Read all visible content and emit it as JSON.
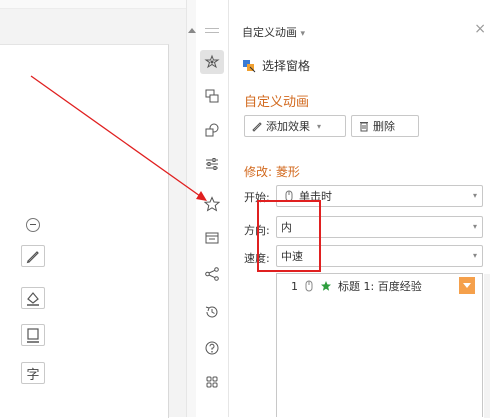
{
  "canvas": {
    "float_tools": [
      {
        "icon": "pen-icon"
      },
      {
        "icon": "shape-fill-icon"
      },
      {
        "icon": "outline-icon"
      },
      {
        "icon": "text-wrap-icon",
        "text": "字"
      }
    ]
  },
  "iconbar": {
    "icons": [
      "animation-icon",
      "transition-icon",
      "shapes-icon",
      "settings-sliders-icon",
      "star-icon",
      "layout-icon",
      "share-icon",
      "history-icon",
      "help-icon",
      "grid-icon"
    ]
  },
  "panel": {
    "title": "自定义动画",
    "title_caret": "▾",
    "close": "×",
    "selection_pane": "选择窗格",
    "section_title": "自定义动画",
    "add_effect": "添加效果",
    "add_effect_caret": "▾",
    "delete": "删除",
    "modify_label": "修改: 菱形",
    "start_label": "开始:",
    "start_value": "单击时",
    "direction_label": "方向:",
    "direction_value": "内",
    "speed_label": "速度:",
    "speed_value": "中速",
    "dd_caret": "▾",
    "list_item": {
      "index": "1",
      "text": "标题 1: 百度经验"
    }
  },
  "colors": {
    "accent": "#d2691e",
    "annotation": "#e02020",
    "list_highlight": "#f5a04b"
  }
}
